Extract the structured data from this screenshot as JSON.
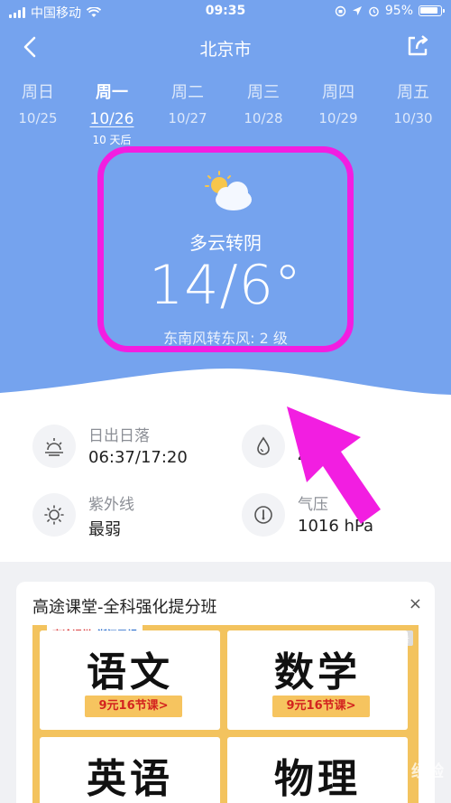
{
  "status_bar": {
    "carrier": "中国移动",
    "time": "09:35",
    "battery_pct": "95%"
  },
  "nav": {
    "city": "北京市"
  },
  "days": [
    {
      "name": "周日",
      "date": "10/25",
      "sub": ""
    },
    {
      "name": "周一",
      "date": "10/26",
      "sub": "10 天后"
    },
    {
      "name": "周二",
      "date": "10/27",
      "sub": ""
    },
    {
      "name": "周三",
      "date": "10/28",
      "sub": ""
    },
    {
      "name": "周四",
      "date": "10/29",
      "sub": ""
    },
    {
      "name": "周五",
      "date": "10/30",
      "sub": ""
    }
  ],
  "weather": {
    "condition": "多云转阴",
    "temperature": "14/6°",
    "wind": "东南风转东风: 2 级"
  },
  "details": {
    "sunrise_label": "日出日落",
    "sunrise_value": "06:37/17:20",
    "humidity_value": "4",
    "uv_label": "紫外线",
    "uv_value": "最弱",
    "pressure_label": "气压",
    "pressure_value": "1016 hPa"
  },
  "ad": {
    "title": "高途课堂-全科强化提分班",
    "close": "×",
    "brand1": "高途课堂",
    "brand2": "浙江卫视",
    "tag": "广告",
    "courses": [
      {
        "name": "语文",
        "price": "9元16节课>"
      },
      {
        "name": "数学",
        "price": "9元16节课>"
      },
      {
        "name": "英语",
        "price": ""
      },
      {
        "name": "物理",
        "price": ""
      }
    ]
  },
  "colors": {
    "sky": "#75a3ee",
    "highlight": "#f21ee1",
    "ad_accent": "#f3c35e"
  },
  "watermark": "Baidu 经验"
}
